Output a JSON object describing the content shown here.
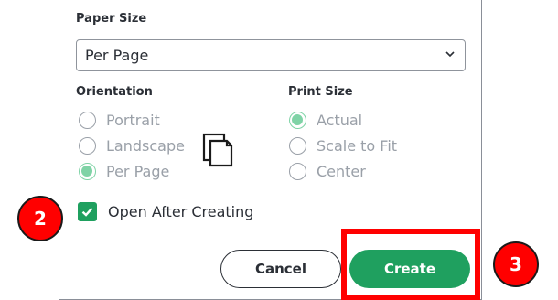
{
  "dialog": {
    "paper_size": {
      "label": "Paper Size",
      "selected": "Per Page"
    },
    "orientation": {
      "label": "Orientation",
      "options": [
        {
          "label": "Portrait",
          "selected": false
        },
        {
          "label": "Landscape",
          "selected": false
        },
        {
          "label": "Per Page",
          "selected": true
        }
      ]
    },
    "print_size": {
      "label": "Print Size",
      "options": [
        {
          "label": "Actual",
          "selected": true
        },
        {
          "label": "Scale to Fit",
          "selected": false
        },
        {
          "label": "Center",
          "selected": false
        }
      ]
    },
    "open_after_creating": {
      "label": "Open After Creating",
      "checked": true
    },
    "buttons": {
      "cancel": "Cancel",
      "create": "Create"
    }
  },
  "annotations": {
    "step_checkbox": "2",
    "step_create": "3"
  },
  "colors": {
    "accent_green": "#1fa05f",
    "radio_selected": "#7fd3a6",
    "annotation_red": "#ff0000"
  },
  "icons": {
    "dropdown": "chevron-down-icon",
    "orientation_preview": "pages-icon",
    "checkbox": "check-icon"
  }
}
